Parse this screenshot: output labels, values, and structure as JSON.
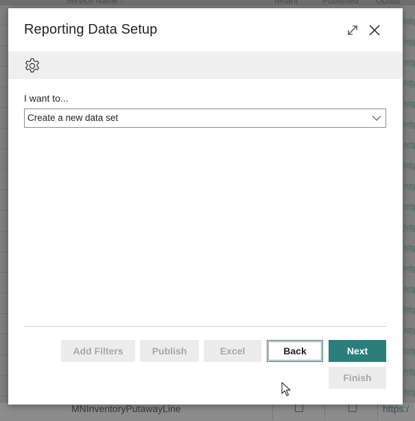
{
  "background": {
    "header_labels": [
      "Service Name ↑",
      "Tenant",
      "Published",
      "OData"
    ],
    "row_link": "https:",
    "bottom_row": {
      "service_name": "MNInventoryPutawayLine",
      "link": "https:/"
    }
  },
  "dialog": {
    "title": "Reporting Data Setup",
    "expand_icon": "expand-icon",
    "close_icon": "close-icon",
    "toolbar": {
      "settings_icon": "gear-icon"
    },
    "field": {
      "label": "I want to...",
      "value": "Create a new data set"
    },
    "buttons": {
      "add_filters": "Add Filters",
      "publish": "Publish",
      "excel": "Excel",
      "back": "Back",
      "next": "Next",
      "finish": "Finish"
    }
  },
  "colors": {
    "accent": "#2b7e7b",
    "disabled_bg": "#ececec",
    "disabled_text": "#a8a8a8"
  }
}
